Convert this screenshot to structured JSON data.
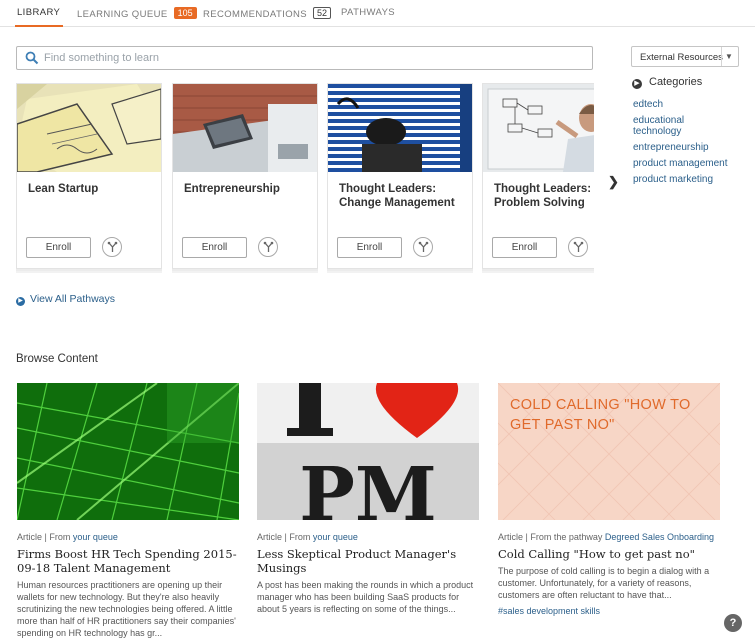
{
  "tabs": [
    {
      "label": "LIBRARY",
      "active": true
    },
    {
      "label": "LEARNING QUEUE",
      "badge": "105"
    },
    {
      "label": "RECOMMENDATIONS",
      "badge": "52"
    },
    {
      "label": "PATHWAYS"
    }
  ],
  "search": {
    "placeholder": "Find something to learn",
    "value": ""
  },
  "external": {
    "label": "External Resources"
  },
  "categories": {
    "title": "Categories",
    "items": [
      "edtech",
      "educational technology",
      "entrepreneurship",
      "product management",
      "product marketing"
    ]
  },
  "pathways": [
    {
      "title": "Lean Startup",
      "enroll": "Enroll"
    },
    {
      "title": "Entrepreneurship",
      "enroll": "Enroll"
    },
    {
      "title": "Thought Leaders: Change Management",
      "enroll": "Enroll"
    },
    {
      "title": "Thought Leaders: Problem Solving",
      "enroll": "Enroll"
    }
  ],
  "view_all": "View All Pathways",
  "browse": {
    "title": "Browse Content",
    "items": [
      {
        "type": "Article |",
        "from": "From",
        "source": "your queue",
        "title": "Firms Boost HR Tech Spending 2015-09-18 Talent Management",
        "desc": "Human resources practitioners are opening up their wallets for new technology. But they're also heavily scrutinizing the new technologies being offered. A little more than half of HR practitioners say their companies' spending on HR technology has gr..."
      },
      {
        "type": "Article |",
        "from": "From",
        "source": "your queue",
        "image_text": "PM",
        "title": "Less Skeptical Product Manager's Musings",
        "desc": "A post has been making the rounds in which a product manager who has been building SaaS products for about 5 years is reflecting on some of the things..."
      },
      {
        "type": "Article |",
        "from": "From the pathway",
        "source": "Degreed Sales Onboarding",
        "image_text": "COLD CALLING \"HOW TO GET PAST NO\"",
        "title": "Cold Calling \"How to get past no\"",
        "desc": "The purpose of cold calling is to begin a dialog with a customer. Unfortunately, for a variety of reasons, customers are often reluctant to have that...",
        "tag": "#sales development skills"
      }
    ]
  },
  "help": "?",
  "colors": {
    "accent": "#e86a24",
    "link": "#2b5f8a",
    "cold_bg": "#f7d6c6"
  }
}
